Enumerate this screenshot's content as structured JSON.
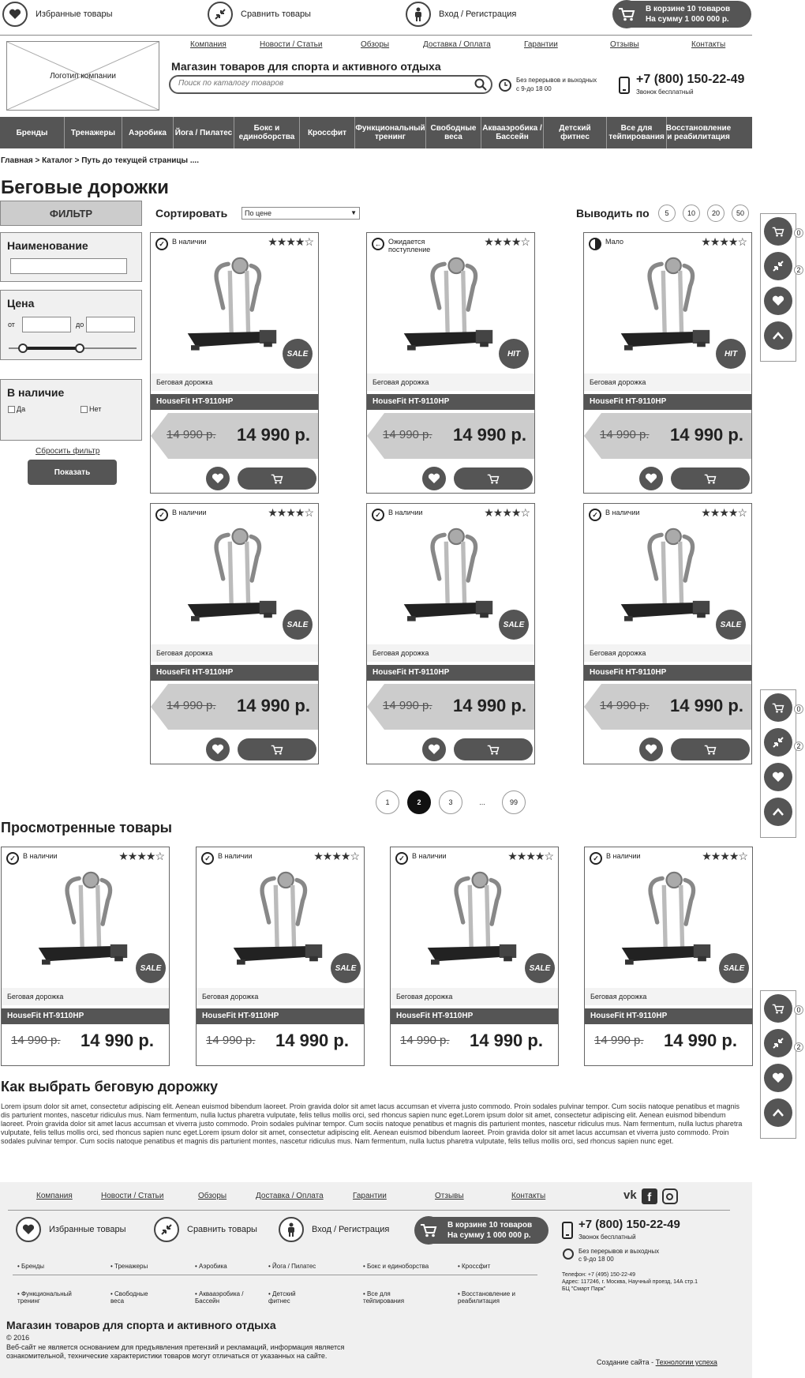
{
  "topbar": {
    "favorites": "Избранные товары",
    "compare": "Сравнить товары",
    "login": "Вход / Регистрация",
    "cart_line1": "В корзине 10 товаров",
    "cart_line2": "На сумму 1 000 000 р."
  },
  "header": {
    "logo": "Логотип компании",
    "links": [
      "Компания",
      "Новости / Статьи",
      "Обзоры",
      "Доставка / Оплата",
      "Гарантии",
      "Отзывы",
      "Контакты"
    ],
    "slogan": "Магазин товаров для спорта и активного отдыха",
    "search_placeholder": "Поиск по каталогу товаров",
    "hours": "Без перерывов и выходных\nс 9-до 18 00",
    "phone": "+7 (800) 150-22-49",
    "phone_note": "Звонок бесплатный"
  },
  "categories": [
    "Бренды",
    "Тренажеры",
    "Аэробика",
    "Йога / Пилатес",
    "Бокс и единоборства",
    "Кроссфит",
    "Функциональный тренинг",
    "Свободные веса",
    "Аквааэробика / Бассейн",
    "Детский фитнес",
    "Все для тейпирования",
    "Восстановление и реабилитация"
  ],
  "breadcrumb": "Главная > Каталог > Путь до текущей страницы ....",
  "page_title": "Беговые дорожки",
  "filter": {
    "title": "ФИЛЬТР",
    "name_label": "Наименование",
    "price_label": "Цена",
    "from": "от",
    "to": "до",
    "stock_label": "В  наличие",
    "yes": "Да",
    "no": "Нет",
    "reset": "Сбросить фильтр",
    "show": "Показать"
  },
  "sort": {
    "label": "Сортировать",
    "value": "По цене",
    "perpage_label": "Выводить по",
    "perpage": [
      "5",
      "10",
      "20",
      "50"
    ]
  },
  "products": [
    {
      "avail": "В наличии",
      "avail_icon": "check",
      "badge": "SALE",
      "category": "Беговая дорожка",
      "name": "HouseFit HT-9110HP",
      "old_price": "14 990 р.",
      "price": "14 990 р.",
      "stars": "★★★★☆"
    },
    {
      "avail": "Ожидается поступление",
      "avail_icon": "arrow",
      "badge": "HIT",
      "category": "Беговая дорожка",
      "name": "HouseFit HT-9110HP",
      "old_price": "14 990 р.",
      "price": "14 990 р.",
      "stars": "★★★★☆"
    },
    {
      "avail": "Мало",
      "avail_icon": "half",
      "badge": "HIT",
      "category": "Беговая дорожка",
      "name": "HouseFit HT-9110HP",
      "old_price": "14 990 р.",
      "price": "14 990 р.",
      "stars": "★★★★☆"
    },
    {
      "avail": "В наличии",
      "avail_icon": "check",
      "badge": "SALE",
      "category": "Беговая дорожка",
      "name": "HouseFit HT-9110HP",
      "old_price": "14 990 р.",
      "price": "14 990 р.",
      "stars": "★★★★☆"
    },
    {
      "avail": "В наличии",
      "avail_icon": "check",
      "badge": "SALE",
      "category": "Беговая дорожка",
      "name": "HouseFit HT-9110HP",
      "old_price": "14 990 р.",
      "price": "14 990 р.",
      "stars": "★★★★☆"
    },
    {
      "avail": "В наличии",
      "avail_icon": "check",
      "badge": "SALE",
      "category": "Беговая дорожка",
      "name": "HouseFit HT-9110HP",
      "old_price": "14 990 р.",
      "price": "14 990 р.",
      "stars": "★★★★☆"
    }
  ],
  "pagination": [
    "1",
    "2",
    "3",
    "...",
    "99"
  ],
  "pagination_active": "2",
  "viewed": {
    "title": "Просмотренные товары",
    "items": [
      {
        "avail": "В наличии",
        "badge": "SALE",
        "category": "Беговая дорожка",
        "name": "HouseFit HT-9110HP",
        "old_price": "14 990 р.",
        "price": "14 990 р.",
        "stars": "★★★★☆"
      },
      {
        "avail": "В наличии",
        "badge": "SALE",
        "category": "Беговая дорожка",
        "name": "HouseFit HT-9110HP",
        "old_price": "14 990 р.",
        "price": "14 990 р.",
        "stars": "★★★★☆"
      },
      {
        "avail": "В наличии",
        "badge": "SALE",
        "category": "Беговая дорожка",
        "name": "HouseFit HT-9110HP",
        "old_price": "14 990 р.",
        "price": "14 990 р.",
        "stars": "★★★★☆"
      },
      {
        "avail": "В наличии",
        "badge": "SALE",
        "category": "Беговая дорожка",
        "name": "HouseFit HT-9110HP",
        "old_price": "14 990 р.",
        "price": "14 990 р.",
        "stars": "★★★★☆"
      }
    ]
  },
  "side_counts": {
    "cart": "0",
    "compare": "2"
  },
  "article": {
    "title": "Как выбрать беговую дорожку",
    "text": "Lorem ipsum dolor sit amet, consectetur adipiscing elit. Aenean euismod bibendum laoreet. Proin gravida dolor sit amet lacus accumsan et viverra justo commodo. Proin sodales pulvinar tempor. Cum sociis natoque penatibus et magnis dis parturient montes, nascetur ridiculus mus. Nam fermentum, nulla luctus pharetra vulputate, felis tellus mollis orci, sed rhoncus sapien nunc eget.Lorem ipsum dolor sit amet, consectetur adipiscing elit. Aenean euismod bibendum laoreet. Proin gravida dolor sit amet lacus accumsan et viverra justo commodo. Proin sodales pulvinar tempor. Cum sociis natoque penatibus et magnis dis parturient montes, nascetur ridiculus mus. Nam fermentum, nulla luctus pharetra vulputate, felis tellus mollis orci, sed rhoncus sapien nunc eget.Lorem ipsum dolor sit amet, consectetur adipiscing elit. Aenean euismod bibendum laoreet. Proin gravida dolor sit amet lacus accumsan et viverra justo commodo. Proin sodales pulvinar tempor. Cum sociis natoque penatibus et magnis dis parturient montes, nascetur ridiculus mus. Nam fermentum, nulla luctus pharetra vulputate, felis tellus mollis orci, sed rhoncus sapien nunc eget."
  },
  "footer": {
    "links": [
      "Компания",
      "Новости / Статьи",
      "Обзоры",
      "Доставка / Оплата",
      "Гарантии",
      "Отзывы",
      "Контакты"
    ],
    "favorites": "Избранные товары",
    "compare": "Сравнить товары",
    "login": "Вход / Регистрация",
    "cart_line1": "В корзине 10 товаров",
    "cart_line2": "На сумму 1 000 000 р.",
    "phone": "+7 (800) 150-22-49",
    "phone_note": "Звонок бесплатный",
    "hours": "Без перерывов и выходных\nс 9-до 18 00",
    "contacts": "Телефон: +7 (495) 150-22-49\nАдрес: 117246, г. Москва, Научный проезд, 14А стр.1\nБЦ \"Смарт Парк\"",
    "cats_row1": [
      "• Бренды",
      "• Тренажеры",
      "• Аэробика",
      "• Йога / Пилатес",
      "• Бокс и единоборства",
      "• Кроссфит"
    ],
    "cats_row2": [
      "• Функциональный\nтренинг",
      "• Свободные\nвеса",
      "• Аквааэробика /\nБассейн",
      "• Детский\nфитнес",
      "• Все для\nтейпирования",
      "• Восстановление и\nреабилитация"
    ],
    "shop_title": "Магазин товаров для спорта и активного отдыха",
    "copyright": "© 2016",
    "disclaimer": "Веб-сайт не является основанием для предъявления претензий и рекламаций, информация является\nознакомительной, технические характеристики товаров могут отличаться от указанных на сайте.",
    "credit_label": "Создание сайта - ",
    "credit_link": "Технологии успеха"
  }
}
